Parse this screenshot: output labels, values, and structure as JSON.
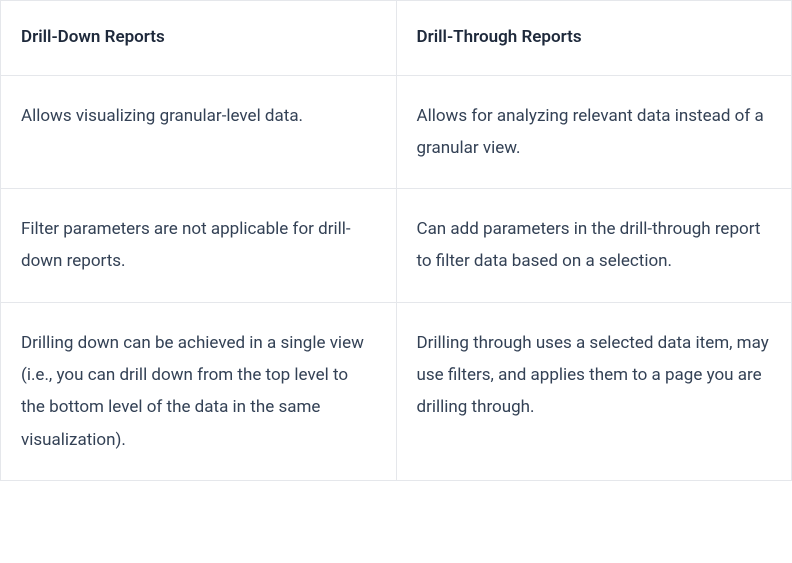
{
  "table": {
    "headers": {
      "col1": "Drill-Down Reports",
      "col2": "Drill-Through Reports"
    },
    "rows": [
      {
        "col1": "Allows visualizing granular-level data.",
        "col2": "Allows for analyzing relevant data instead of a granular view."
      },
      {
        "col1": "Filter parameters are not applicable for drill-down reports.",
        "col2": "Can add parameters in the drill-through report to filter data based on a selection."
      },
      {
        "col1": "Drilling down can be achieved in a single view (i.e., you can drill down from the top level to the bottom level of the data in the same visualization).",
        "col2": "Drilling through uses a selected data item, may use filters, and applies them to a page you are drilling through."
      }
    ]
  }
}
